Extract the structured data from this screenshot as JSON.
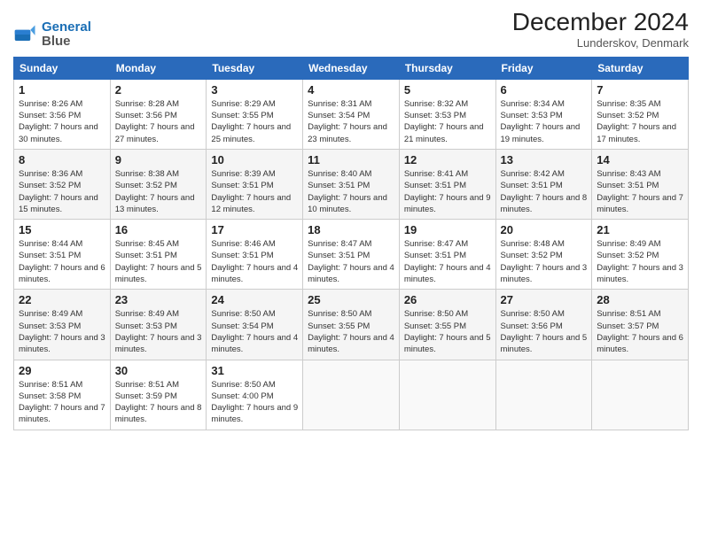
{
  "logo": {
    "line1": "General",
    "line2": "Blue"
  },
  "title": "December 2024",
  "location": "Lunderskov, Denmark",
  "days_header": [
    "Sunday",
    "Monday",
    "Tuesday",
    "Wednesday",
    "Thursday",
    "Friday",
    "Saturday"
  ],
  "weeks": [
    [
      {
        "day": "1",
        "sunrise": "8:26 AM",
        "sunset": "3:56 PM",
        "daylight": "7 hours and 30 minutes."
      },
      {
        "day": "2",
        "sunrise": "8:28 AM",
        "sunset": "3:56 PM",
        "daylight": "7 hours and 27 minutes."
      },
      {
        "day": "3",
        "sunrise": "8:29 AM",
        "sunset": "3:55 PM",
        "daylight": "7 hours and 25 minutes."
      },
      {
        "day": "4",
        "sunrise": "8:31 AM",
        "sunset": "3:54 PM",
        "daylight": "7 hours and 23 minutes."
      },
      {
        "day": "5",
        "sunrise": "8:32 AM",
        "sunset": "3:53 PM",
        "daylight": "7 hours and 21 minutes."
      },
      {
        "day": "6",
        "sunrise": "8:34 AM",
        "sunset": "3:53 PM",
        "daylight": "7 hours and 19 minutes."
      },
      {
        "day": "7",
        "sunrise": "8:35 AM",
        "sunset": "3:52 PM",
        "daylight": "7 hours and 17 minutes."
      }
    ],
    [
      {
        "day": "8",
        "sunrise": "8:36 AM",
        "sunset": "3:52 PM",
        "daylight": "7 hours and 15 minutes."
      },
      {
        "day": "9",
        "sunrise": "8:38 AM",
        "sunset": "3:52 PM",
        "daylight": "7 hours and 13 minutes."
      },
      {
        "day": "10",
        "sunrise": "8:39 AM",
        "sunset": "3:51 PM",
        "daylight": "7 hours and 12 minutes."
      },
      {
        "day": "11",
        "sunrise": "8:40 AM",
        "sunset": "3:51 PM",
        "daylight": "7 hours and 10 minutes."
      },
      {
        "day": "12",
        "sunrise": "8:41 AM",
        "sunset": "3:51 PM",
        "daylight": "7 hours and 9 minutes."
      },
      {
        "day": "13",
        "sunrise": "8:42 AM",
        "sunset": "3:51 PM",
        "daylight": "7 hours and 8 minutes."
      },
      {
        "day": "14",
        "sunrise": "8:43 AM",
        "sunset": "3:51 PM",
        "daylight": "7 hours and 7 minutes."
      }
    ],
    [
      {
        "day": "15",
        "sunrise": "8:44 AM",
        "sunset": "3:51 PM",
        "daylight": "7 hours and 6 minutes."
      },
      {
        "day": "16",
        "sunrise": "8:45 AM",
        "sunset": "3:51 PM",
        "daylight": "7 hours and 5 minutes."
      },
      {
        "day": "17",
        "sunrise": "8:46 AM",
        "sunset": "3:51 PM",
        "daylight": "7 hours and 4 minutes."
      },
      {
        "day": "18",
        "sunrise": "8:47 AM",
        "sunset": "3:51 PM",
        "daylight": "7 hours and 4 minutes."
      },
      {
        "day": "19",
        "sunrise": "8:47 AM",
        "sunset": "3:51 PM",
        "daylight": "7 hours and 4 minutes."
      },
      {
        "day": "20",
        "sunrise": "8:48 AM",
        "sunset": "3:52 PM",
        "daylight": "7 hours and 3 minutes."
      },
      {
        "day": "21",
        "sunrise": "8:49 AM",
        "sunset": "3:52 PM",
        "daylight": "7 hours and 3 minutes."
      }
    ],
    [
      {
        "day": "22",
        "sunrise": "8:49 AM",
        "sunset": "3:53 PM",
        "daylight": "7 hours and 3 minutes."
      },
      {
        "day": "23",
        "sunrise": "8:49 AM",
        "sunset": "3:53 PM",
        "daylight": "7 hours and 3 minutes."
      },
      {
        "day": "24",
        "sunrise": "8:50 AM",
        "sunset": "3:54 PM",
        "daylight": "7 hours and 4 minutes."
      },
      {
        "day": "25",
        "sunrise": "8:50 AM",
        "sunset": "3:55 PM",
        "daylight": "7 hours and 4 minutes."
      },
      {
        "day": "26",
        "sunrise": "8:50 AM",
        "sunset": "3:55 PM",
        "daylight": "7 hours and 5 minutes."
      },
      {
        "day": "27",
        "sunrise": "8:50 AM",
        "sunset": "3:56 PM",
        "daylight": "7 hours and 5 minutes."
      },
      {
        "day": "28",
        "sunrise": "8:51 AM",
        "sunset": "3:57 PM",
        "daylight": "7 hours and 6 minutes."
      }
    ],
    [
      {
        "day": "29",
        "sunrise": "8:51 AM",
        "sunset": "3:58 PM",
        "daylight": "7 hours and 7 minutes."
      },
      {
        "day": "30",
        "sunrise": "8:51 AM",
        "sunset": "3:59 PM",
        "daylight": "7 hours and 8 minutes."
      },
      {
        "day": "31",
        "sunrise": "8:50 AM",
        "sunset": "4:00 PM",
        "daylight": "7 hours and 9 minutes."
      },
      null,
      null,
      null,
      null
    ]
  ]
}
